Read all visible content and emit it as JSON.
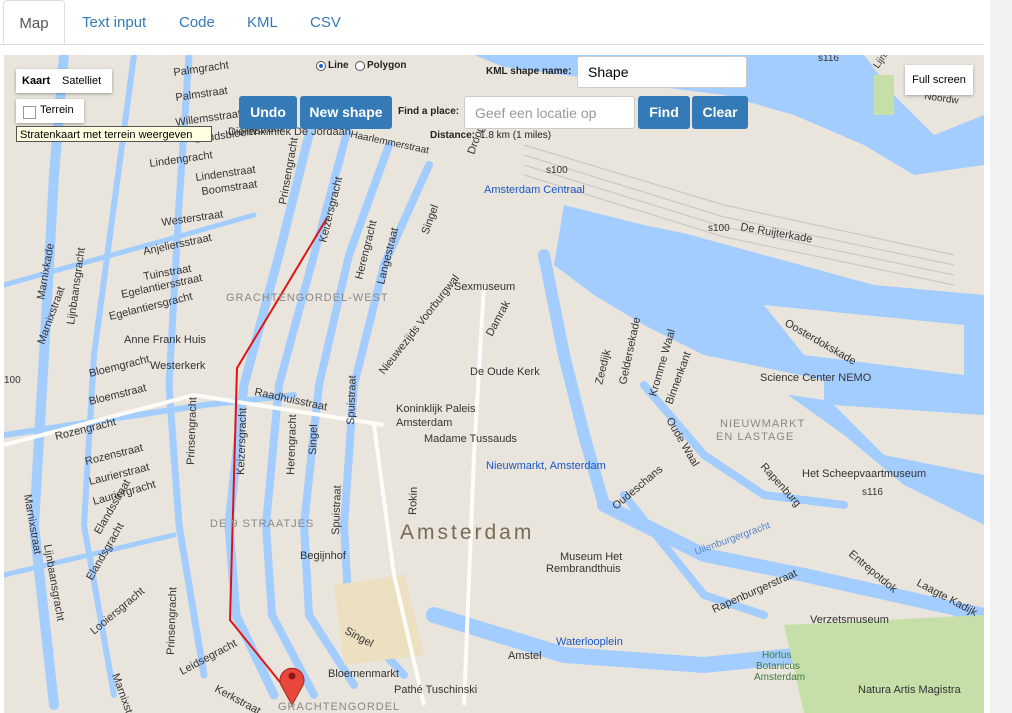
{
  "tabs": [
    {
      "label": "Map"
    },
    {
      "label": "Text input"
    },
    {
      "label": "Code"
    },
    {
      "label": "KML"
    },
    {
      "label": "CSV"
    }
  ],
  "map_type": {
    "kaart": "Kaart",
    "satelliet": "Satelliet",
    "terrain": "Terrein",
    "tooltip": "Stratenkaart met terrein weergeven"
  },
  "shape_mode": {
    "line": "Line",
    "polygon": "Polygon",
    "selected": "Line"
  },
  "kml_shape": {
    "label": "KML shape name:",
    "value": "Shape"
  },
  "buttons": {
    "undo": "Undo",
    "new_shape": "New shape",
    "find": "Find",
    "clear": "Clear",
    "full_screen": "Full screen"
  },
  "find_place": {
    "label": "Find a place:",
    "placeholder": "Geef een locatie op"
  },
  "distance": {
    "label": "Distance:",
    "value": "1.8 km (1 miles)"
  },
  "map": {
    "city": "Amsterdam",
    "districts": {
      "west": "GRACHTENGORDEL-WEST",
      "negen": "DE 9 STRAATJES",
      "gordel": "GRACHTENGORDEL",
      "nieuwmarkt_1": "NIEUWMARKT",
      "nieuwmarkt_2": "EN LASTAGE"
    },
    "streets": {
      "palmgracht": "Palmgracht",
      "palmstraat": "Palmstraat",
      "willemsstraat": "Willemsstraat",
      "goudsbloemstraat": "Goudsbloemstraat",
      "lindengracht": "Lindengracht",
      "lindenstraat": "Lindenstraat",
      "boomstraat": "Boomstraat",
      "westerstraat": "Westerstraat",
      "anjeliersstraat": "Anjeliersstraat",
      "tuinstraat": "Tuinstraat",
      "egelantiersstraat": "Egelantiersstraat",
      "egelantiersgracht": "Egelantiersgracht",
      "bloemgracht": "Bloemgracht",
      "bloemstraat": "Bloemstraat",
      "rozengracht": "Rozengracht",
      "rozenstraat": "Rozenstraat",
      "laurierstraat": "Laurierstraat",
      "lauriergracht": "Lauriergracht",
      "elandsstraat": "Elandsstraat",
      "elandsgracht": "Elandsgracht",
      "looiersgracht": "Looiersgracht",
      "marnixstraat": "Marnixstraat",
      "marnixkade": "Marnixkade",
      "lijnbaansgracht": "Lijnbaansgracht",
      "prinsengracht": "Prinsengracht",
      "keizersgracht": "Keizersgracht",
      "herengracht": "Herengracht",
      "singel": "Singel",
      "langestraat": "Langestraat",
      "raadhuisstraat": "Raadhuisstraat",
      "nieuwezijds": "Nieuwezijds Voorburgwal",
      "spuistraat": "Spuistraat",
      "damrak": "Damrak",
      "rokin": "Rokin",
      "zeedijk": "Zeedijk",
      "geldersekade": "Geldersekade",
      "kromme_waal": "Kromme Waal",
      "binnenkant": "Binnenkant",
      "oude_waal": "Oude Waal",
      "oudeschans": "Oudeschans",
      "rapenburg": "Rapenburg",
      "rapenburgerstraat": "Rapenburgerstraat",
      "entrepotdok": "Entrepotdok",
      "laagte_kadijk": "Laagte Kadijk",
      "oosterdokskade": "Oosterdokskade",
      "de_ruijterkade": "De Ruijterkade",
      "droogbak": "Droogbak",
      "haarlemmerstraat": "Haarlemmerstraat",
      "amstel": "Amstel",
      "leidsegracht": "Leidsegracht",
      "kerkstraat": "Kerkstraat",
      "uilenburgergracht": "Uilenburgergracht",
      "noordw": "Noordw",
      "lijnb": "Lijnb"
    },
    "pois": {
      "dierenkliniek": "Dierenkliniek De Jordaan",
      "anne_frank": "Anne Frank Huis",
      "westerkerk": "Westerkerk",
      "sexmuseum": "Sexmuseum",
      "centraal": "Amsterdam Centraal",
      "oude_kerk": "De Oude Kerk",
      "paleis_1": "Koninklijk Paleis",
      "paleis_2": "Amsterdam",
      "tussauds": "Madame Tussauds",
      "nieuwmarkt_station": "Nieuwmarkt, Amsterdam",
      "nemo": "Science Center NEMO",
      "scheepvaart": "Het Scheepvaartmuseum",
      "begijnhof": "Begijnhof",
      "rembrandt_1": "Museum Het",
      "rembrandt_2": "Rembrandthuis",
      "verzets": "Verzetsmuseum",
      "waterlooplein": "Waterlooplein",
      "bloemenmarkt": "Bloemenmarkt",
      "tuschinski": "Pathé Tuschinski",
      "hortus_1": "Hortus",
      "hortus_2": "Botanicus",
      "hortus_3": "Amsterdam",
      "artis": "Natura Artis Magistra"
    },
    "shields": {
      "s100": "s100",
      "s116": "s116",
      "edge100": "100"
    }
  },
  "colors": {
    "water": "#a3ccff",
    "road": "#ffffff",
    "major_road": "#fdfcf8",
    "land": "#e9e5dc",
    "route": "#e01414",
    "marker": "#e8473b",
    "park": "#c6dfa8",
    "button": "#337ab7",
    "rail": "#c9c9c9"
  }
}
